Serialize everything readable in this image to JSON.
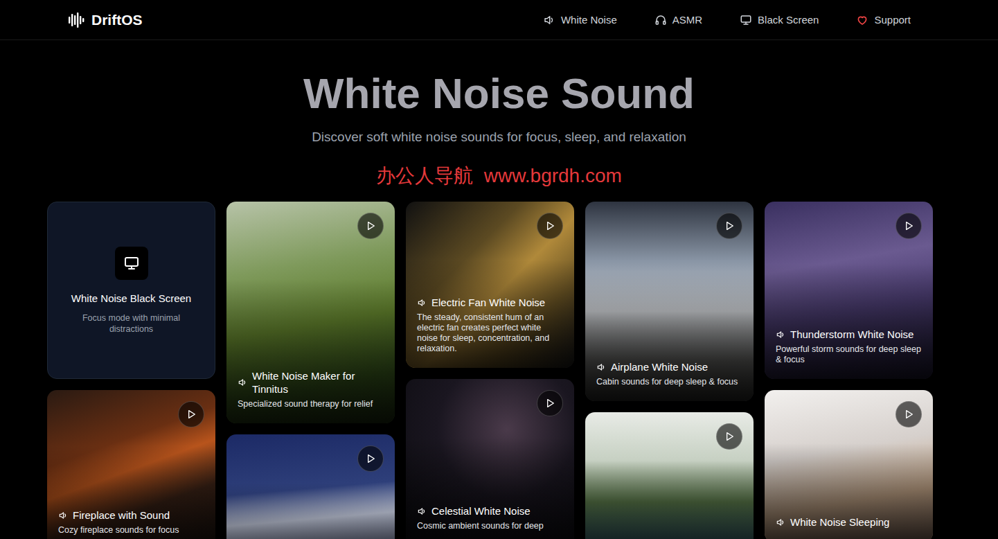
{
  "brand": "DriftOS",
  "nav": [
    {
      "label": "White Noise"
    },
    {
      "label": "ASMR"
    },
    {
      "label": "Black Screen"
    },
    {
      "label": "Support"
    }
  ],
  "hero": {
    "title": "White Noise Sound",
    "subtitle": "Discover soft white noise sounds for focus, sleep, and relaxation"
  },
  "watermark": "办公人导航  www.bgrdh.com",
  "columns": [
    [
      {
        "kind": "screen",
        "title": "White Noise Black Screen",
        "desc": "Focus mode with minimal distractions"
      },
      {
        "kind": "sound",
        "title": "Fireplace with Sound",
        "desc": "Cozy fireplace sounds for focus"
      }
    ],
    [
      {
        "kind": "sound",
        "title": "White Noise Maker for Tinnitus",
        "desc": "Specialized sound therapy for relief"
      },
      {
        "kind": "sound"
      }
    ],
    [
      {
        "kind": "sound",
        "title": "Electric Fan White Noise",
        "desc": "The steady, consistent hum of an electric fan creates perfect white noise for sleep, concentration, and relaxation."
      },
      {
        "kind": "sound",
        "title": "Celestial White Noise",
        "desc": "Cosmic ambient sounds for deep"
      }
    ],
    [
      {
        "kind": "sound",
        "title": "Airplane White Noise",
        "desc": "Cabin sounds for deep sleep & focus"
      },
      {
        "kind": "sound"
      }
    ],
    [
      {
        "kind": "sound",
        "title": "Thunderstorm White Noise",
        "desc": "Powerful storm sounds for deep sleep & focus"
      },
      {
        "kind": "sound",
        "title": "White Noise Sleeping"
      }
    ]
  ]
}
